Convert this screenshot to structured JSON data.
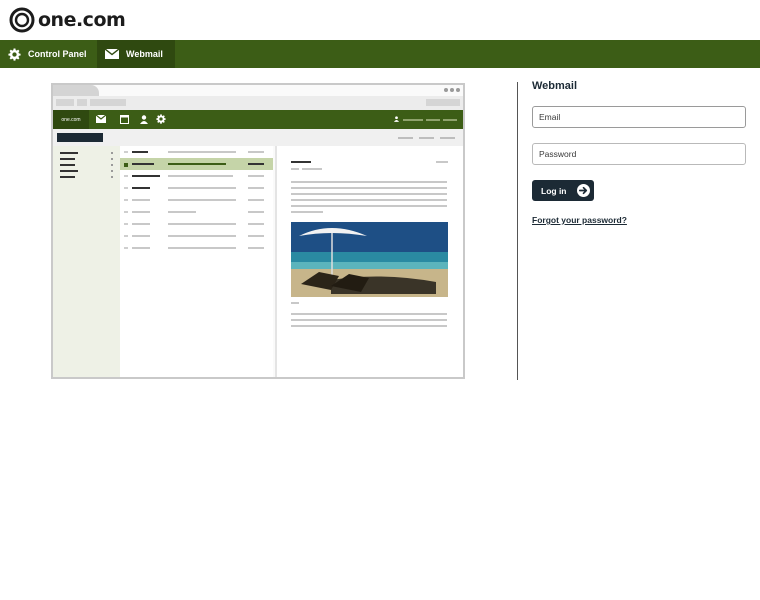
{
  "brand": {
    "logo_text": "one.com"
  },
  "nav": {
    "items": [
      {
        "label": "Control Panel",
        "icon": "gear-icon"
      },
      {
        "label": "Webmail",
        "icon": "envelope-icon",
        "active": true
      }
    ]
  },
  "illustration": {
    "mini_logo": "one.com",
    "icons": [
      "envelope-icon",
      "calendar-icon",
      "user-icon",
      "gear-icon"
    ]
  },
  "login": {
    "title": "Webmail",
    "email_placeholder": "Email",
    "password_placeholder": "Password",
    "login_button": "Log in",
    "forgot_link": "Forgot your password?"
  },
  "colors": {
    "nav_bg": "#3c5d16",
    "nav_active_bg": "#2f4910",
    "button_bg": "#1c2a35",
    "text_dark": "#1c2a35"
  }
}
